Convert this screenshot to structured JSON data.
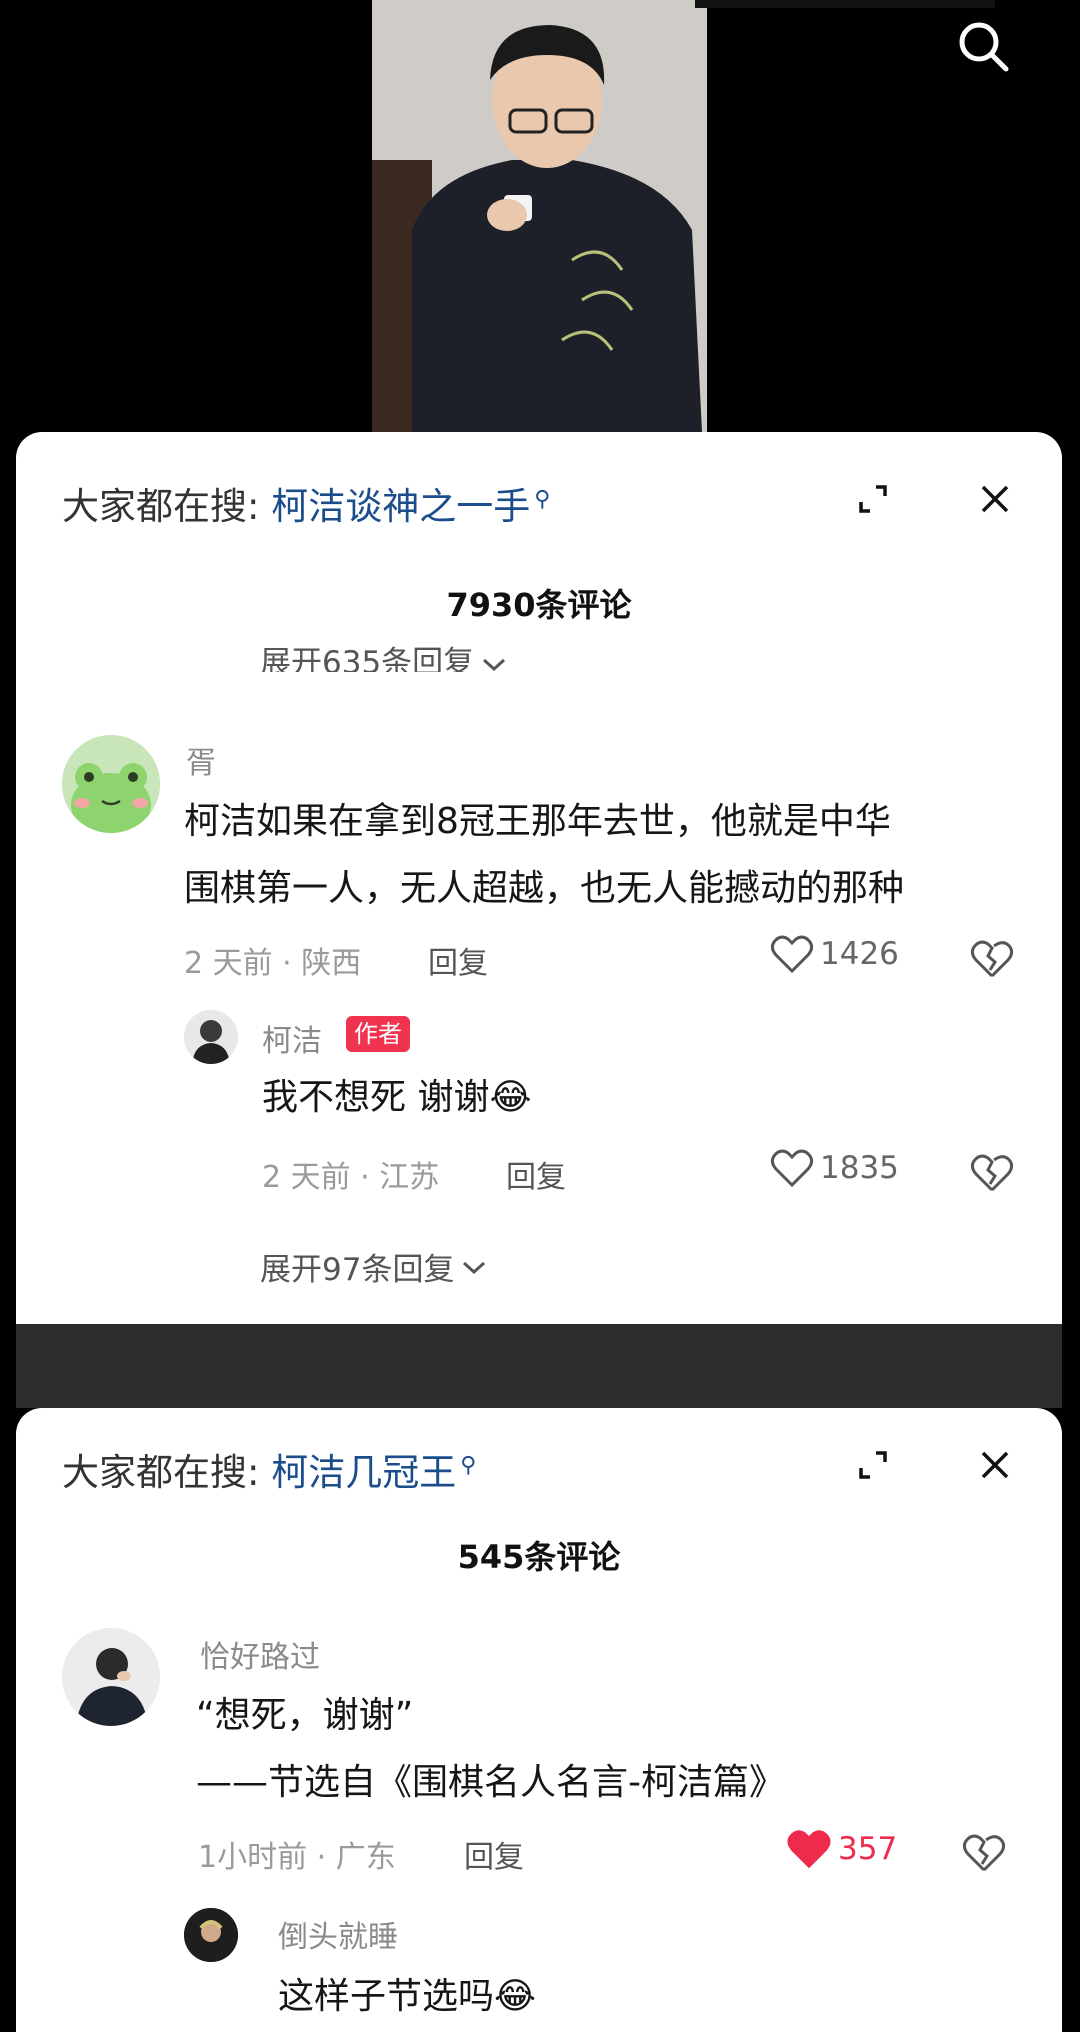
{
  "panel1": {
    "search_prefix": "大家都在搜:",
    "search_term": "柯洁谈神之一手",
    "comment_count": "7930条评论",
    "prev_expand": "展开635条回复",
    "comment": {
      "username": "胥",
      "line1": "柯洁如果在拿到8冠王那年去世，他就是中华",
      "line2": "围棋第一人，无人超越，也无人能撼动的那种",
      "meta": "2 天前 · 陕西",
      "reply_label": "回复",
      "likes": "1426"
    },
    "reply": {
      "username": "柯洁",
      "badge": "作者",
      "text": "我不想死 谢谢",
      "emoji": "😂",
      "meta": "2 天前 · 江苏",
      "reply_label": "回复",
      "likes": "1835"
    },
    "expand_more": "展开97条回复"
  },
  "panel2": {
    "search_prefix": "大家都在搜:",
    "search_term": "柯洁几冠王",
    "comment_count": "545条评论",
    "comment": {
      "username": "恰好路过",
      "line1": "“想死，谢谢”",
      "line2": "——节选自《围棋名人名言-柯洁篇》",
      "meta": "1小时前 · 广东",
      "reply_label": "回复",
      "likes": "357",
      "liked": true
    },
    "reply": {
      "username": "倒头就睡",
      "text": "这样子节选吗",
      "emoji": "😂"
    }
  },
  "colors": {
    "link": "#1c4d8b",
    "badge": "#f0334f",
    "liked": "#ee2a4d"
  }
}
